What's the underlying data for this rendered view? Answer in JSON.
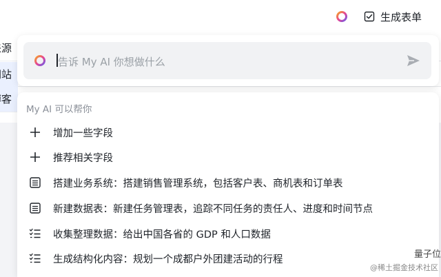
{
  "topbar": {
    "ai_icon": "ai-ring-icon",
    "generate_form_icon": "checkbox-form-icon",
    "generate_form_label": "生成表单"
  },
  "background_table": {
    "cells": [
      "来源",
      "网站",
      "博客"
    ]
  },
  "ai_input": {
    "logo_icon": "ai-ring-icon",
    "placeholder": "告诉 My AI 你想做什么",
    "send_icon": "send-icon"
  },
  "menu": {
    "header": "My AI 可以帮你",
    "items": [
      {
        "icon": "plus-icon",
        "label": "增加一些字段"
      },
      {
        "icon": "plus-icon",
        "label": "推荐相关字段"
      },
      {
        "icon": "table-icon",
        "label": "搭建业务系统：搭建销售管理系统，包括客户表、商机表和订单表"
      },
      {
        "icon": "table-icon",
        "label": "新建数据表：新建任务管理表，追踪不同任务的责任人、进度和时间节点"
      },
      {
        "icon": "checklist-icon",
        "label": "收集整理数据：给出中国各省的 GDP 和人口数据"
      },
      {
        "icon": "checklist-icon",
        "label": "生成结构化内容：规划一个成都户外团建活动的行程"
      }
    ]
  },
  "watermark": {
    "line1": "量子位",
    "line2": "@稀土掘金技术社区"
  },
  "colors": {
    "accent_gradient": [
      "#f5a623",
      "#e84393",
      "#6c5ce7"
    ],
    "text": "#1f2329",
    "muted": "#9aa0a6",
    "selected_row": "#eaf0fe"
  }
}
